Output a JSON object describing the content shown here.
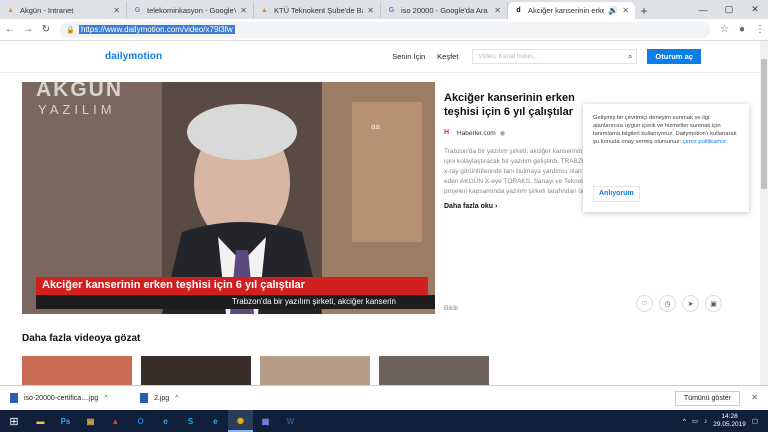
{
  "browser": {
    "tabs": [
      {
        "title": "Akgün - Intranet",
        "favicon": "akgun-logo",
        "color": "#e98a1b",
        "active": false
      },
      {
        "title": "telekominkasyon - Google'da Ara",
        "favicon": "google-logo",
        "color": "#4285f4",
        "active": false
      },
      {
        "title": "KTÜ Teknokent Şube'de Bayrak...",
        "favicon": "akgun-logo",
        "color": "#e98a1b",
        "active": false
      },
      {
        "title": "iso 20000 - Google'da Ara",
        "favicon": "google-logo",
        "color": "#4285f4",
        "active": false
      },
      {
        "title": "Akciğer kanserinin erken teş...",
        "favicon": "dailymotion-logo",
        "color": "#111111",
        "active": true
      }
    ],
    "url": "https://www.dailymotion.com/video/x79l3fw"
  },
  "site": {
    "logo": "dailymotion",
    "nav": [
      "Senin İçin",
      "Keşfet"
    ],
    "search_placeholder": "Video, Kanal bulun...",
    "login_label": "Oturum aç",
    "video": {
      "brand_top": "AKGÜN",
      "brand_sub": "YAZILIM",
      "watermark": "aa",
      "lower_third": "Akciğer kanserinin erken teşhisi için 6 yıl çalıştılar",
      "ticker": "Trabzon'da bir yazılım şirketi, akciğer kanserin"
    },
    "title": "Akciğer kanserinin erken teşhisi için 6 yıl çalıştılar",
    "channel": "Haberler.com",
    "description": "Trabzon'da bir yazılım şirketi, akciğer kanserinin erken teşhisi ile hastaların hem de doktorların işini kolaylaştıracak bir yazılım geliştirdi. TRABZON (İHA) - DUYGU AVUNDUK - Akciğer kanseri x-ray görüntülerinde tanı bulmaya yardımcı olan ve yüzde 85 oranında kanserli hücreyi tespit eden AKGÜN X-eye TORAKS, Sanayi ve Teknoloji Bakanlığı ile TÜBİTAK destekli AR-GE projeleri kapsamında yazılım şirketi tarafından üretildi...",
    "more_label": "Daha fazla oku",
    "report_label": "Bildir",
    "section_title": "Daha fazla videoya gözat",
    "cookie": {
      "text": "Gelişmiş bir çevrimiçi deneyim sunmak ve ilgi alanlarınıza uygun içerik ve hizmetler sunmak için tanımlama bilgileri kullanıyoruz. Dailymotion'ı kullanarak şu konuda onay vermiş olursunuz:",
      "link": "çerez politikamız.",
      "button": "Anlıyorum"
    }
  },
  "downloads": {
    "items": [
      "iso-20000-certifica....jpg",
      "2.jpg"
    ],
    "show_all": "Tümünü göster"
  },
  "taskbar": {
    "time": "14:28",
    "date": "29.05.2019",
    "apps": [
      "explorer",
      "ps",
      "file-manager",
      "pdf",
      "outlook",
      "ie",
      "skype",
      "edge",
      "chrome",
      "teams",
      "word"
    ]
  }
}
